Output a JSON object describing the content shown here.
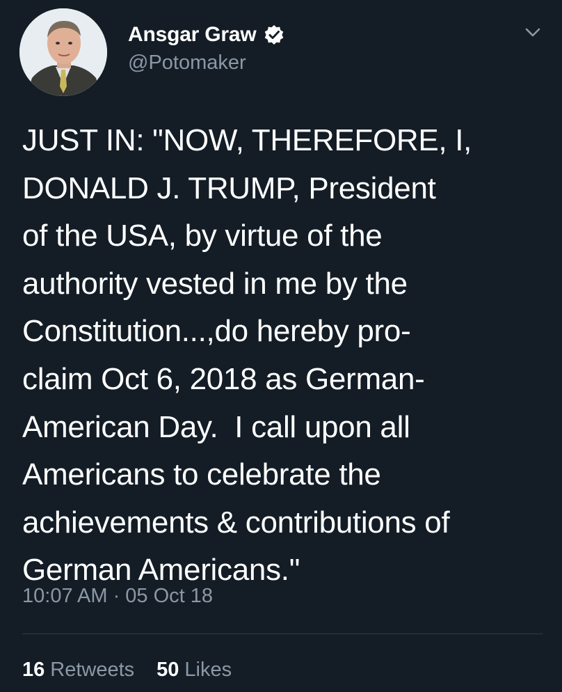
{
  "tweet": {
    "author": {
      "display_name": "Ansgar Graw",
      "handle": "@Potomaker",
      "verified": true,
      "avatar_icon": "avatar-photo"
    },
    "menu_icon": "chevron-down-icon",
    "text_lines": [
      "JUST IN: \"NOW, THEREFORE, I,",
      "DONALD J. TRUMP, President",
      "of the USA, by virtue of the",
      "authority vested in me by the",
      "Constitution...,do hereby pro-",
      "claim Oct 6, 2018 as German-",
      "American Day.  I call upon all",
      "Americans to celebrate the",
      "achievements & contributions of",
      "German Americans.\""
    ],
    "timestamp": "10:07 AM · 05 Oct 18",
    "stats": {
      "retweets_count": "16",
      "retweets_label": "Retweets",
      "likes_count": "50",
      "likes_label": "Likes"
    }
  },
  "colors": {
    "background": "#141d26",
    "text": "#ffffff",
    "secondary_text": "#8b98a5",
    "divider": "#2c3a47"
  }
}
